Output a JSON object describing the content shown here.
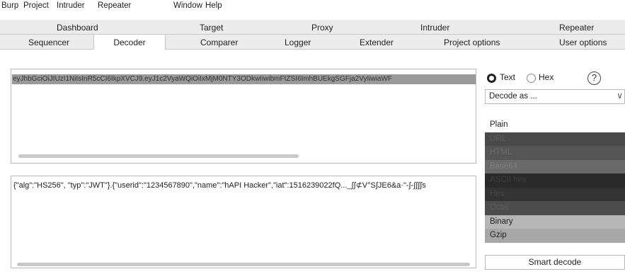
{
  "menu": [
    "Burp",
    "Project",
    "Intruder",
    "Repeater",
    "Window",
    "Help"
  ],
  "tabs_row1": [
    "Dashboard",
    "Target",
    "Proxy",
    "Intruder",
    "Repeater"
  ],
  "tabs_row2": [
    "Sequencer",
    "Decoder",
    "Comparer",
    "Logger",
    "Extender",
    "Project options",
    "User options"
  ],
  "active_tab": "Decoder",
  "input": {
    "value": "eyJhbGciOiJIUzI1NiIsInR5cCI6IkpXVCJ9.eyJ1c2VyaWQiOiIxMjM0NTY3ODkwIiwibmFtZSI6ImhBUEkgSGFja2VyIiwiaWF"
  },
  "output": {
    "value": "{\"alg\":\"HS256\", \"typ\":\"JWT\"}.{\"userid\":\"1234567890\",\"name\":\"hAPI Hacker\",\"iat\":1516239022fQ..._∫∫⊄V°S∫JE6&a·\"-∫-∫∫∫∫s"
  },
  "mode": {
    "text_label": "Text",
    "hex_label": "Hex",
    "selected": "Text",
    "help_label": "?"
  },
  "decode_select": {
    "value": "Decode as ...",
    "chevron": "∨"
  },
  "decode_options": [
    "Plain",
    "URL",
    "HTML",
    "Base64",
    "ASCII hex",
    "Hex",
    "Octal",
    "Binary",
    "Gzip"
  ],
  "smart_decode_label": "Smart decode",
  "colors": {
    "tab_bg": "#ececec",
    "input_highlight": "#9a9a9a",
    "list_shades": [
      "#ffffff",
      "#4a4a4a",
      "#555555",
      "#6a6a6a",
      "#2a2a2a",
      "#333333",
      "#4c4c4c",
      "#b5b5b5",
      "#a7a7a7"
    ]
  }
}
